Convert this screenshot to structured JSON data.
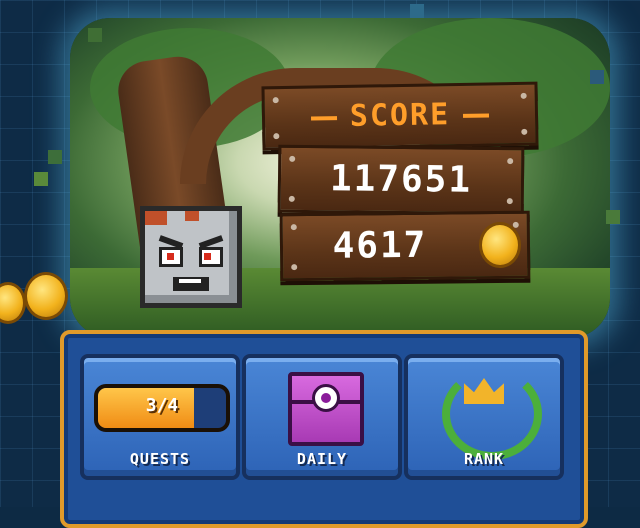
{
  "score_board": {
    "title": "SCORE",
    "score": "117651",
    "coins": "4617"
  },
  "menu": {
    "quests": {
      "label": "QUESTS",
      "progress_text": "3/4",
      "progress_fraction": 0.75
    },
    "daily": {
      "label": "DAILY"
    },
    "rank": {
      "label": "RANK"
    }
  },
  "colors": {
    "score_title": "#ff9e2a",
    "panel_border": "#e09a2a",
    "panel_bg": "#1f4f97",
    "chest": "#c653d2",
    "crown": "#f2b42a",
    "wreath": "#4caf3a"
  },
  "icons": {
    "coin": "gold-coin-icon",
    "enemy": "angry-stone-block",
    "daily": "purple-chest-eye-icon",
    "rank": "crown-wreath-icon"
  }
}
